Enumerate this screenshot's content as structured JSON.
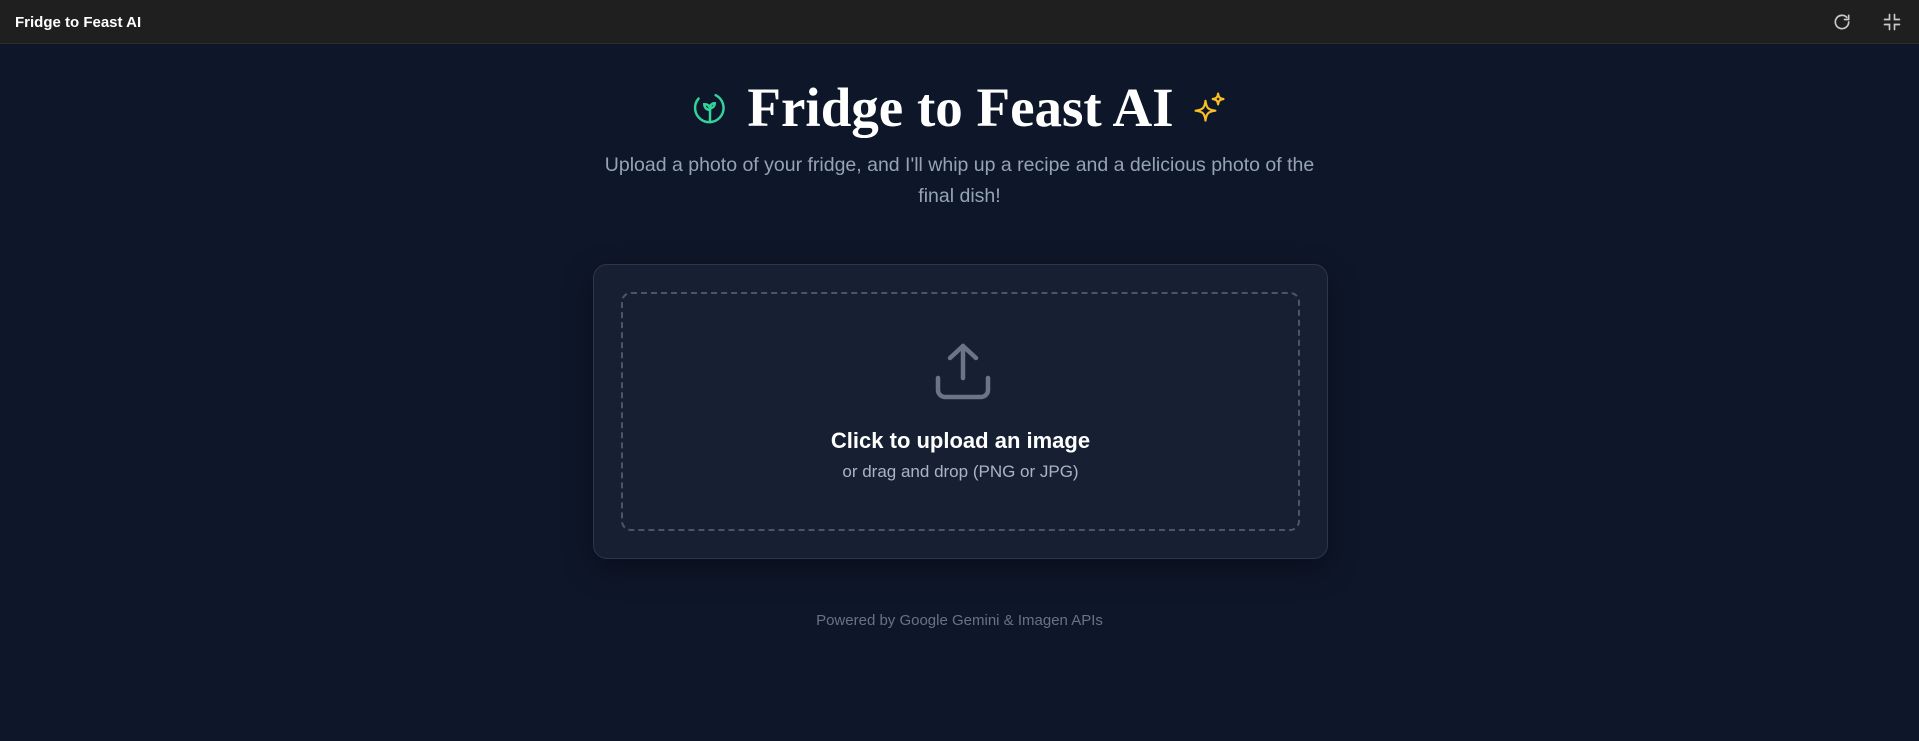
{
  "topbar": {
    "title": "Fridge to Feast AI",
    "refresh_icon": "refresh-icon",
    "collapse_icon": "collapse-fullscreen-icon"
  },
  "header": {
    "leaf_icon": "leaf-icon",
    "title": "Fridge to Feast AI",
    "sparkle_icon": "sparkles-icon",
    "subtitle": "Upload a photo of your fridge, and I'll whip up a recipe and a delicious photo of the final dish!"
  },
  "upload": {
    "icon": "upload-icon",
    "title": "Click to upload an image",
    "hint": "or drag and drop (PNG or JPG)"
  },
  "footer": {
    "text": "Powered by Google Gemini & Imagen APIs"
  },
  "colors": {
    "background": "#0e1629",
    "topbar": "#1f1f1f",
    "card": "#172032",
    "leaf_accent": "#34d399",
    "sparkle_accent": "#fbbf24",
    "muted_text": "#94a3b8"
  }
}
